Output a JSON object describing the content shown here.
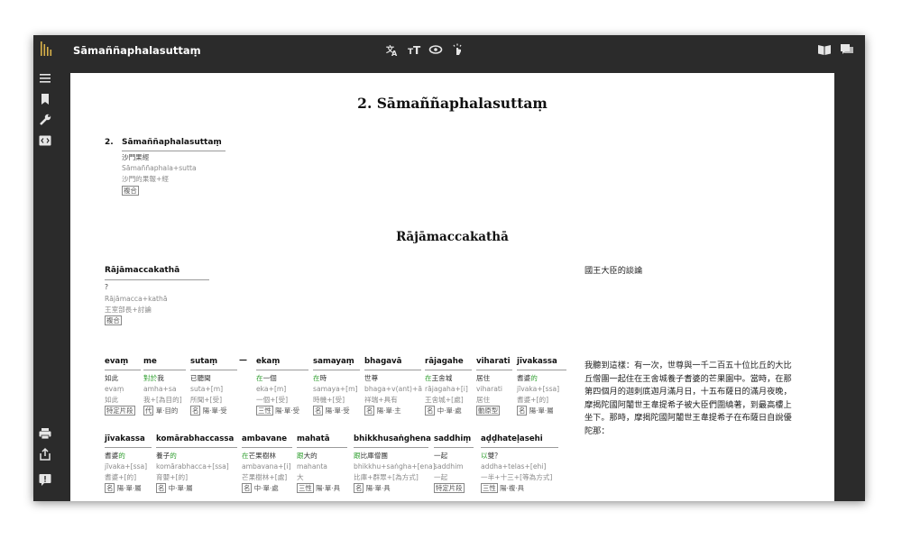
{
  "app": {
    "title": "Sāmaññaphalasuttaṃ"
  },
  "toolbar": {
    "center_icons": [
      "translate-icon",
      "font-size-icon",
      "view-icon",
      "touch-icon"
    ],
    "right_icons": [
      "book-icon",
      "comment-icon"
    ]
  },
  "sidebar": {
    "top_icons": [
      "list-icon",
      "bookmark-icon",
      "wrench-icon",
      "code-icon"
    ],
    "bottom_icons": [
      "print-icon",
      "share-icon",
      "feedback-icon"
    ]
  },
  "page": {
    "heading1": "2. Sāmaññaphalasuttaṃ",
    "item1": {
      "number": "2.",
      "word": "Sāmaññaphalasuttaṃ",
      "zh": "沙門果經",
      "parts": "Sāmaññaphala+sutta",
      "gloss": "沙門的果報+經",
      "tag": "複合"
    },
    "heading2": "Rājāmaccakathā",
    "item2": {
      "word": "Rājāmaccakathā",
      "zh": "?",
      "parts": "Rājāmacca+kathā",
      "gloss": "王室部長+討論",
      "tag": "複合"
    },
    "item2_translation": "國王大臣的談論",
    "dash": "—",
    "row1": [
      {
        "pali": "evaṃ",
        "zh_pre": "",
        "zh_green": "",
        "zh": "如此",
        "sub1": "evaṃ",
        "sub2": "如此",
        "tag1": "特定片段",
        "tags": ""
      },
      {
        "pali": "me",
        "zh_pre": "",
        "zh_green": "對於",
        "zh": "我",
        "sub1": "amha+sa",
        "sub2": "我+[為目的]",
        "tag1": "代",
        "tags": "單·目的"
      },
      {
        "pali": "sutaṃ",
        "zh_pre": "",
        "zh_green": "",
        "zh": "已聽聞",
        "sub1": "suta+[m]",
        "sub2": "所聞+[受]",
        "tag1": "名",
        "tags": "陽·單·受"
      },
      {
        "pali": "ekaṃ",
        "zh_pre": "",
        "zh_green": "在",
        "zh": "一個",
        "sub1": "eka+[m]",
        "sub2": "一個+[受]",
        "tag1": "三性",
        "tags": "陽·單·受"
      },
      {
        "pali": "samayaṃ",
        "zh_pre": "",
        "zh_green": "在",
        "zh": "時",
        "sub1": "samaya+[m]",
        "sub2": "時機+[受]",
        "tag1": "名",
        "tags": "陽·單·受"
      },
      {
        "pali": "bhagavā",
        "zh_pre": "",
        "zh_green": "",
        "zh": "世尊",
        "sub1": "bhaga+v(ant)+ā",
        "sub2": "祥瑞+具有",
        "tag1": "名",
        "tags": "陽·單·主"
      },
      {
        "pali": "rājagahe",
        "zh_pre": "",
        "zh_green": "在",
        "zh": "王舍城",
        "sub1": "rājagaha+[i]",
        "sub2": "王舍城+[處]",
        "tag1": "名",
        "tags": "中·單·處"
      },
      {
        "pali": "viharati",
        "zh_pre": "",
        "zh_green": "",
        "zh": "居住",
        "sub1": "viharati",
        "sub2": "居住",
        "tag1": "動原型",
        "tags": ""
      },
      {
        "pali": "jīvakassa",
        "zh_pre": "耆婆",
        "zh_green": "的",
        "zh": "",
        "sub1": "jīvaka+[ssa]",
        "sub2": "耆婆+[的]",
        "tag1": "名",
        "tags": "陽·單·屬"
      }
    ],
    "row2": [
      {
        "pali": "jīvakassa",
        "zh_pre": "耆婆",
        "zh_green": "的",
        "zh": "",
        "sub1": "jīvaka+[ssa]",
        "sub2": "耆婆+[的]",
        "tag1": "名",
        "tags": "陽·單·屬"
      },
      {
        "pali": "komārabhaccassa",
        "zh_pre": "養子",
        "zh_green": "的",
        "zh": "",
        "sub1": "komārabhacca+[ssa]",
        "sub2": "育嬰+[的]",
        "tag1": "名",
        "tags": "中·單·屬"
      },
      {
        "pali": "ambavane",
        "zh_pre": "",
        "zh_green": "在",
        "zh": "芒果樹林",
        "sub1": "ambavana+[i]",
        "sub2": "芒果樹林+[處]",
        "tag1": "名",
        "tags": "中·單·處"
      },
      {
        "pali": "mahatā",
        "zh_pre": "",
        "zh_green": "跟",
        "zh": "大的",
        "sub1": "mahanta",
        "sub2": "大",
        "tag1": "三性",
        "tags": "陽·單·具"
      },
      {
        "pali": "bhikkhusaṅghena",
        "zh_pre": "",
        "zh_green": "跟",
        "zh": "比庫僧團",
        "sub1": "bhikkhu+saṅgha+[ena]",
        "sub2": "比庫+群眾+[為方式]",
        "tag1": "名",
        "tags": "陽·單·具"
      },
      {
        "pali": "saddhiṃ",
        "zh_pre": "",
        "zh_green": "",
        "zh": "一起",
        "sub1": "saddhim",
        "sub2": "一起",
        "tag1": "特定片段",
        "tags": ""
      },
      {
        "pali": "aḍḍhateḷasehi",
        "zh_pre": "",
        "zh_green": "以",
        "zh": "雙？",
        "sub1": "addha+telas+[ehi]",
        "sub2": "一半+十三+[等為方式]",
        "tag1": "三性",
        "tags": "陽·複·具"
      }
    ],
    "translation_para": "我聽到這樣：有一次，世尊與一千二百五十位比丘的大比丘僧團一起住在王舍城養子耆婆的芒果園中。當時，在那第四個月的迦刺底迦月滿月日，十五布薩日的滿月夜晚，摩揭陀國阿闍世王韋提希子被大臣們圍繞著，到最高樓上坐下。那時，摩揭陀國阿闍世王韋提希子在布薩日自說優陀那："
  }
}
